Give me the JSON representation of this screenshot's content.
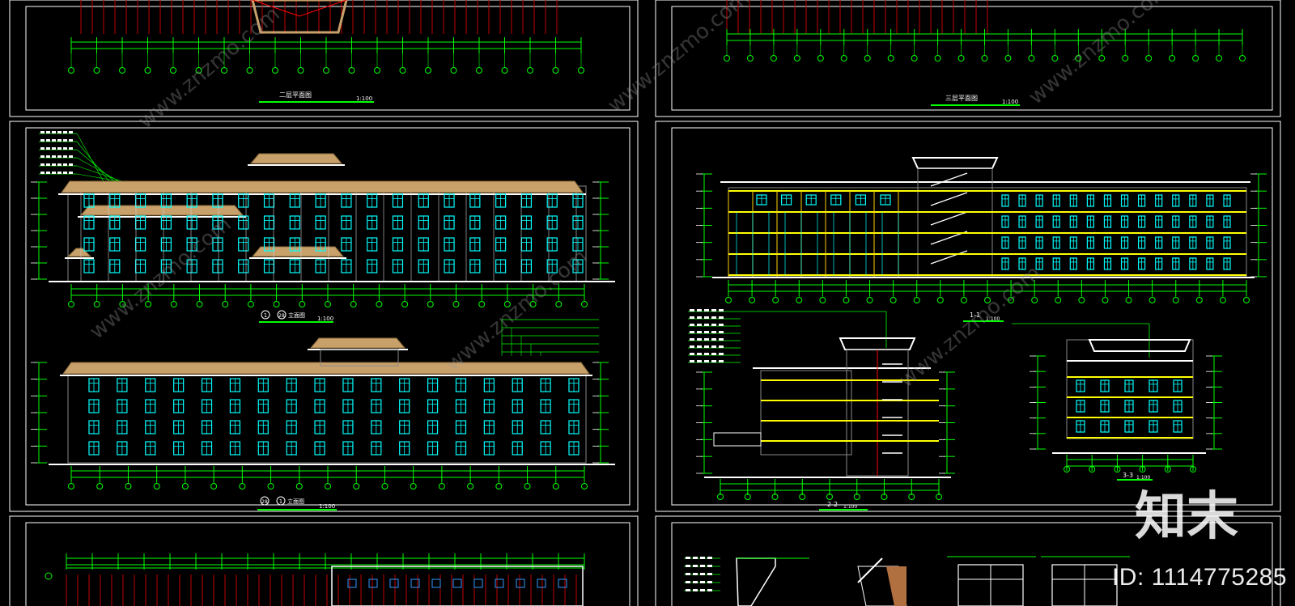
{
  "sheets": [
    {
      "id": "floor2",
      "title": "二层平面图",
      "scale": "1:100"
    },
    {
      "id": "floor3",
      "title": "三层平面图",
      "scale": "1:100"
    },
    {
      "id": "elev1",
      "title_a": "1",
      "title_b": "28",
      "title_c": "立面图",
      "scale": "1:100"
    },
    {
      "id": "elev2",
      "title_a": "28",
      "title_b": "1",
      "title_c": "立面图",
      "scale": "1:100"
    },
    {
      "id": "sec11",
      "title": "1-1",
      "scale": "1:100"
    },
    {
      "id": "sec22",
      "title": "2-2",
      "scale": "1:100"
    },
    {
      "id": "sec33",
      "title": "3-3",
      "scale": "1:100"
    }
  ],
  "watermark": {
    "logo": "知末",
    "id_text": "ID: 1114775285",
    "site": "www.znzmo.com"
  },
  "colors": {
    "background": "#000000",
    "frame": "#ffffff",
    "dim": "#00ff00",
    "grid": "#ff0000",
    "window": "#00ffff",
    "roof": "#c8a06a",
    "floorline": "#ffff00",
    "text": "#ffffff"
  }
}
